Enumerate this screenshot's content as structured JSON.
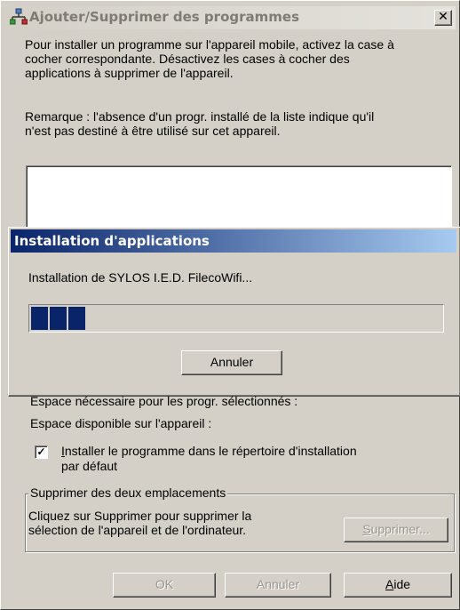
{
  "main_window": {
    "title": "Ajouter/Supprimer des programmes",
    "close_glyph": "✕",
    "intro_lines": [
      "Pour installer un programme sur l'appareil mobile, activez la case à",
      "cocher correspondante. Désactivez les cases à cocher des",
      "applications à supprimer de l'appareil."
    ],
    "remark_lines": [
      "Remarque : l'absence d'un progr. installé de la liste indique qu'il",
      "n'est pas destiné à être utilisé sur cet appareil."
    ],
    "space_required_label": "Espace nécessaire pour les progr. sélectionnés :",
    "space_available_label": "Espace disponible sur l'appareil :",
    "default_dir_checkbox": {
      "checked": true,
      "label_first_letter": "I",
      "label_line1_rest": "nstaller le programme dans le répertoire d'installation",
      "label_line2": "par défaut"
    },
    "remove_group": {
      "legend": "Supprimer des deux emplacements",
      "text_line1": "Cliquez sur Supprimer pour supprimer la",
      "text_line2": "sélection de l'appareil et de l'ordinateur.",
      "remove_button_first": "S",
      "remove_button_rest": "upprimer..."
    },
    "ok_label": "OK",
    "cancel_label": "Annuler",
    "help_first": "A",
    "help_rest": "ide"
  },
  "progress_dialog": {
    "title": "Installation d'applications",
    "message": "Installation de SYLOS I.E.D. FilecoWifi...",
    "progress_percent": 14,
    "cancel_label": "Annuler"
  },
  "colors": {
    "face": "#d4d0c8",
    "progress_fill": "#0a246a",
    "active_title_start": "#0a246a",
    "active_title_end": "#a6caf0"
  }
}
